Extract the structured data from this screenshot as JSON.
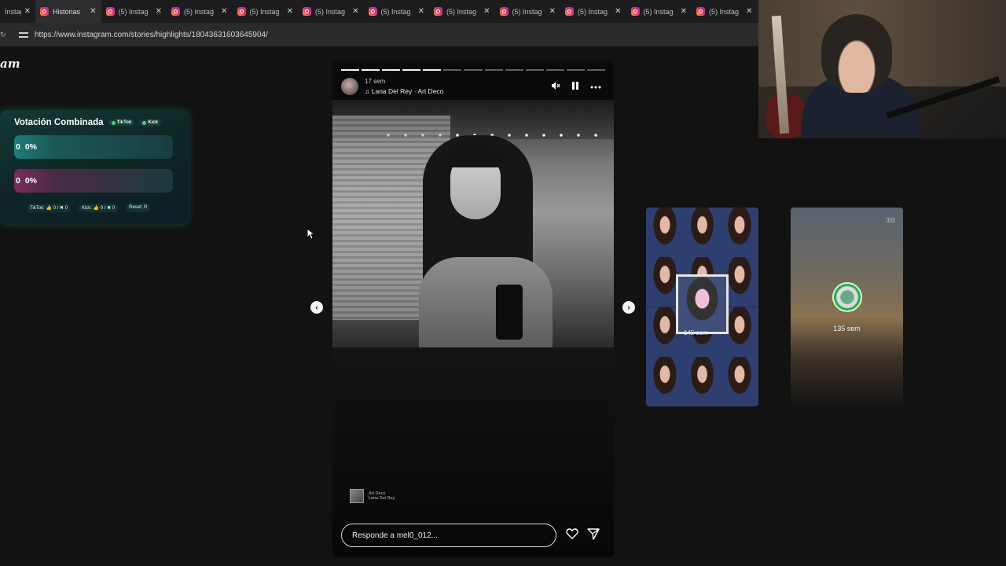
{
  "browser": {
    "tabs": [
      {
        "label": "Instag",
        "active": false
      },
      {
        "label": "Historias",
        "active": true
      },
      {
        "label": "(5) Instag",
        "active": false
      },
      {
        "label": "(5) Instag",
        "active": false
      },
      {
        "label": "(5) Instag",
        "active": false
      },
      {
        "label": "(5) Instag",
        "active": false
      },
      {
        "label": "(5) Instag",
        "active": false
      },
      {
        "label": "(5) Instag",
        "active": false
      },
      {
        "label": "(5) Instag",
        "active": false
      },
      {
        "label": "(5) Instag",
        "active": false
      },
      {
        "label": "(5) Instag",
        "active": false
      },
      {
        "label": "(5) Instag",
        "active": false
      }
    ],
    "tab_close_glyph": "✕",
    "url": "https://www.instagram.com/stories/highlights/18043631603645904/"
  },
  "site": {
    "logo_fragment": "am"
  },
  "vote_widget": {
    "title": "Votación Combinada",
    "badge_tiktok": "TikTok",
    "badge_kick": "Kick",
    "bar1_count": "0",
    "bar1_pct": "0%",
    "bar2_count": "0",
    "bar2_pct": "0%",
    "footer_tiktok": "TikTok: 👍 0 / ✖ 0",
    "footer_kick": "Kick: 👍 0 / ✖ 0",
    "footer_reset": "Reset: R",
    "colors": {
      "tiktok": "#1d7d7a",
      "kick": "#7a2d5a",
      "live_dot": "#39d67a"
    }
  },
  "story": {
    "time_ago": "17 sem",
    "song": "Lana Del Rey · Art Deco",
    "progress_segments_total": 13,
    "progress_segments_done": 5,
    "music_title": "Art Deco",
    "music_artist": "Lana Del Rey",
    "reply_placeholder": "Responde a mel0_012...",
    "icons": [
      "mute-icon",
      "pause-icon",
      "more-icon",
      "heart-icon",
      "send-icon"
    ]
  },
  "nav": {
    "prev_glyph": "‹",
    "next_glyph": "›"
  },
  "prev_story": {
    "time_ago": "145 sem"
  },
  "next_story": {
    "time_ago": "135 sem",
    "corner_glyph": "▯▯▯"
  }
}
